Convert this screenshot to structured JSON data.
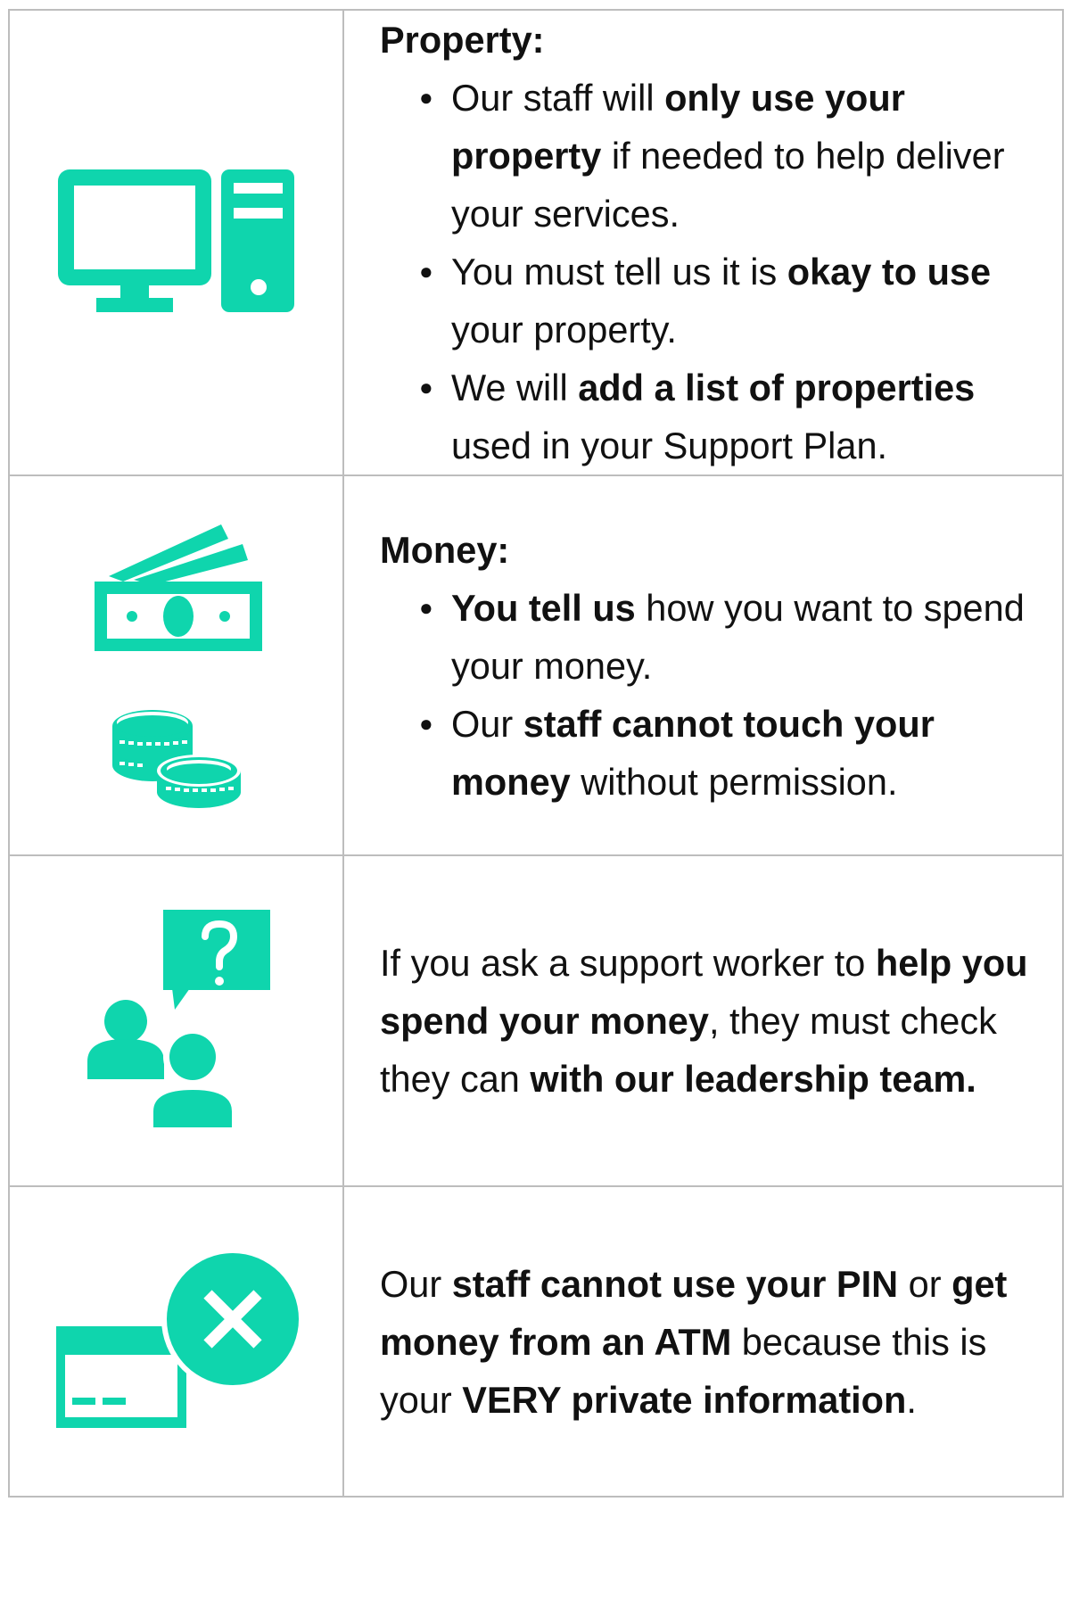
{
  "accent_color": "#0fd5ad",
  "rows": [
    {
      "icon": "desktop-computer-icon",
      "heading": "Property:",
      "bullets": [
        [
          {
            "t": "Our staff will ",
            "b": false
          },
          {
            "t": "only use your property",
            "b": true
          },
          {
            "t": " if needed to help deliver your services.",
            "b": false
          }
        ],
        [
          {
            "t": "You must tell us it is ",
            "b": false
          },
          {
            "t": "okay to use",
            "b": true
          },
          {
            "t": " your property.",
            "b": false
          }
        ],
        [
          {
            "t": "We will ",
            "b": false
          },
          {
            "t": "add a list of properties",
            "b": true
          },
          {
            "t": " used in your Support Plan.",
            "b": false
          }
        ]
      ]
    },
    {
      "icon": "money-banknotes-and-coins-icon",
      "heading": "Money:",
      "bullets": [
        [
          {
            "t": "You tell us",
            "b": true
          },
          {
            "t": " how you want to spend your money.",
            "b": false
          }
        ],
        [
          {
            "t": "Our ",
            "b": false
          },
          {
            "t": "staff cannot touch your money",
            "b": true
          },
          {
            "t": " without permission.",
            "b": false
          }
        ]
      ]
    },
    {
      "icon": "people-question-icon",
      "paragraph": [
        {
          "t": "If you ask a support worker to ",
          "b": false
        },
        {
          "t": "help you spend your money",
          "b": true
        },
        {
          "t": ", they must check they can ",
          "b": false
        },
        {
          "t": "with our leadership team.",
          "b": true
        }
      ]
    },
    {
      "icon": "card-no-pin-icon",
      "paragraph": [
        {
          "t": "Our ",
          "b": false
        },
        {
          "t": "staff cannot use your PIN",
          "b": true
        },
        {
          "t": " or ",
          "b": false
        },
        {
          "t": "get money from an ATM",
          "b": true
        },
        {
          "t": " because this is your ",
          "b": false
        },
        {
          "t": "VERY private information",
          "b": true
        },
        {
          "t": ".",
          "b": false
        }
      ]
    }
  ]
}
